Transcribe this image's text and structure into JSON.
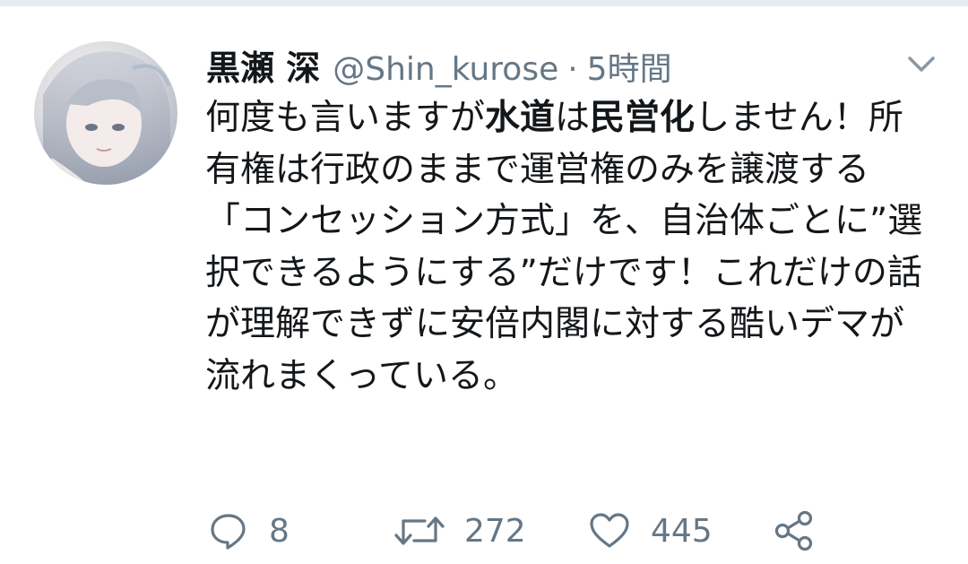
{
  "tweet": {
    "display_name": "黒瀬 深",
    "handle": "@Shin_kurose",
    "separator": "·",
    "time": "5時間",
    "text_segments": [
      {
        "text": "何度も言いますが",
        "bold": false
      },
      {
        "text": "水道",
        "bold": true
      },
      {
        "text": "は",
        "bold": false
      },
      {
        "text": "民営化",
        "bold": true
      },
      {
        "text": "しません！所有権は行政のままで運営権のみを譲渡する「コンセッション方式」を、自治体ごとに”選択できるようにする”だけです！これだけの話が理解できずに安倍内閣に対する酷いデマが流れまくっている。",
        "bold": false
      }
    ],
    "actions": {
      "reply_count": "8",
      "retweet_count": "272",
      "like_count": "445"
    }
  },
  "icons": {
    "caret": "chevron-down-icon",
    "reply": "reply-icon",
    "retweet": "retweet-icon",
    "like": "heart-icon",
    "share": "share-icon"
  },
  "colors": {
    "text": "#14171a",
    "secondary": "#657786",
    "top_strip": "#e6ecf0"
  }
}
